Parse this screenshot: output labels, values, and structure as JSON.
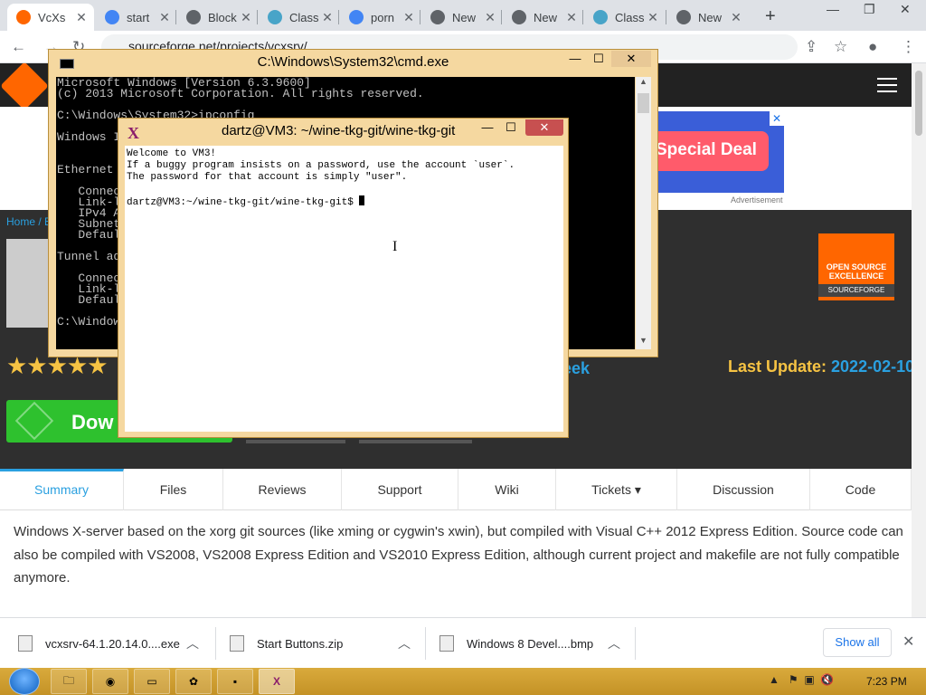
{
  "browser": {
    "tabs": [
      {
        "title": "VcXs",
        "icon_color": "#ff6600",
        "active": true
      },
      {
        "title": "start",
        "icon_color": "#4285f4"
      },
      {
        "title": "Block",
        "icon_color": "#5f6368"
      },
      {
        "title": "Class",
        "icon_color": "#48a4c8"
      },
      {
        "title": "porn",
        "icon_color": "#4285f4"
      },
      {
        "title": "New",
        "icon_color": "#5f6368"
      },
      {
        "title": "New",
        "icon_color": "#5f6368"
      },
      {
        "title": "Class",
        "icon_color": "#48a4c8"
      },
      {
        "title": "New",
        "icon_color": "#5f6368"
      }
    ],
    "url": "sourceforge.net/projects/vcxsrv/",
    "new_tab": "+",
    "close_glyph": "✕"
  },
  "page": {
    "ad_button": "Special Deal",
    "ad_label": "Advertisement",
    "breadcrumb": "Home / B",
    "badge_line1": "OPEN SOURCE",
    "badge_line2": "EXCELLENCE",
    "badge_brand": "SOURCEFORGE",
    "stars": "★★★★★",
    "week_fragment": "eek",
    "last_update_label": "Last Update:",
    "last_update_value": "2022-02-10",
    "download_label": "Dow",
    "tabs": [
      "Summary",
      "Files",
      "Reviews",
      "Support",
      "Wiki",
      "Tickets ▾",
      "Discussion",
      "Code"
    ],
    "description": "Windows X-server based on the xorg git sources (like xming or cygwin's xwin), but compiled with Visual C++ 2012 Express Edition. Source code can also be compiled with VS2008, VS2008 Express Edition and VS2010 Express Edition, although current project and makefile are not fully compatible anymore."
  },
  "downloads": {
    "items": [
      "vcxsrv-64.1.20.14.0....exe",
      "Start Buttons.zip",
      "Windows 8 Devel....bmp"
    ],
    "show_all": "Show all"
  },
  "cmd": {
    "title": "C:\\Windows\\System32\\cmd.exe",
    "lines": [
      "Microsoft Windows [Version 6.3.9600]",
      "(c) 2013 Microsoft Corporation. All rights reserved.",
      "",
      "C:\\Windows\\System32>ipconfig",
      "",
      "Windows I",
      "",
      "",
      "Ethernet",
      "",
      "   Connec",
      "   Link-l",
      "   IPv4 A",
      "   Subnet",
      "   Defaul",
      "",
      "Tunnel ad",
      "",
      "   Connec",
      "   Link-l",
      "   Defaul",
      "",
      "C:\\Window"
    ]
  },
  "terminal": {
    "title": "dartz@VM3: ~/wine-tkg-git/wine-tkg-git",
    "lines": [
      "Welcome to VM3!",
      "If a buggy program insists on a password, use the account `user`.",
      "The password for that account is simply \"user\".",
      ""
    ],
    "prompt": "dartz@VM3:~/wine-tkg-git/wine-tkg-git$ "
  },
  "taskbar": {
    "clock": "7:23 PM"
  }
}
